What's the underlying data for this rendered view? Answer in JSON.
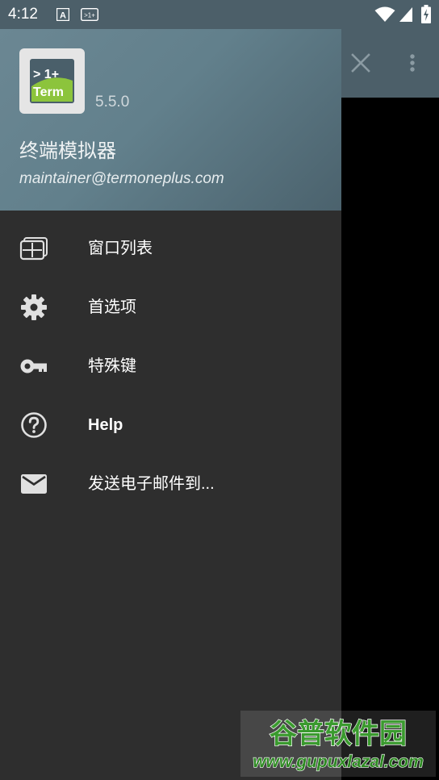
{
  "status_bar": {
    "time": "4:12",
    "icons": [
      "font-notification-icon",
      "term-notification-icon",
      "wifi-icon",
      "signal-icon",
      "battery-charging-icon"
    ]
  },
  "app_bar": {
    "close_icon": "close-icon",
    "overflow_icon": "more-vert-icon"
  },
  "drawer": {
    "header": {
      "logo_line1": "> 1+",
      "logo_line2": "Term",
      "version": "5.5.0",
      "app_name": "终端模拟器",
      "email": "maintainer@termoneplus.com"
    },
    "items": [
      {
        "label": "窗口列表",
        "icon": "window-list-icon"
      },
      {
        "label": "首选项",
        "icon": "settings-gear-icon"
      },
      {
        "label": "特殊键",
        "icon": "key-icon"
      },
      {
        "label": "Help",
        "icon": "help-circle-icon"
      },
      {
        "label": "发送电子邮件到...",
        "icon": "email-icon"
      }
    ]
  },
  "watermark": {
    "title": "谷普软件园",
    "url": "www.gupuxlazal.com"
  },
  "colors": {
    "status_bar": "#4c5f69",
    "drawer_bg": "#2e2e2e",
    "header_gradient_start": "#6b8793",
    "header_gradient_end": "#4b626d",
    "logo_green": "#8cc43c",
    "logo_dark": "#4a5f6a",
    "icon_color": "#e0e0e0",
    "watermark_green": "#3a9a2e"
  }
}
